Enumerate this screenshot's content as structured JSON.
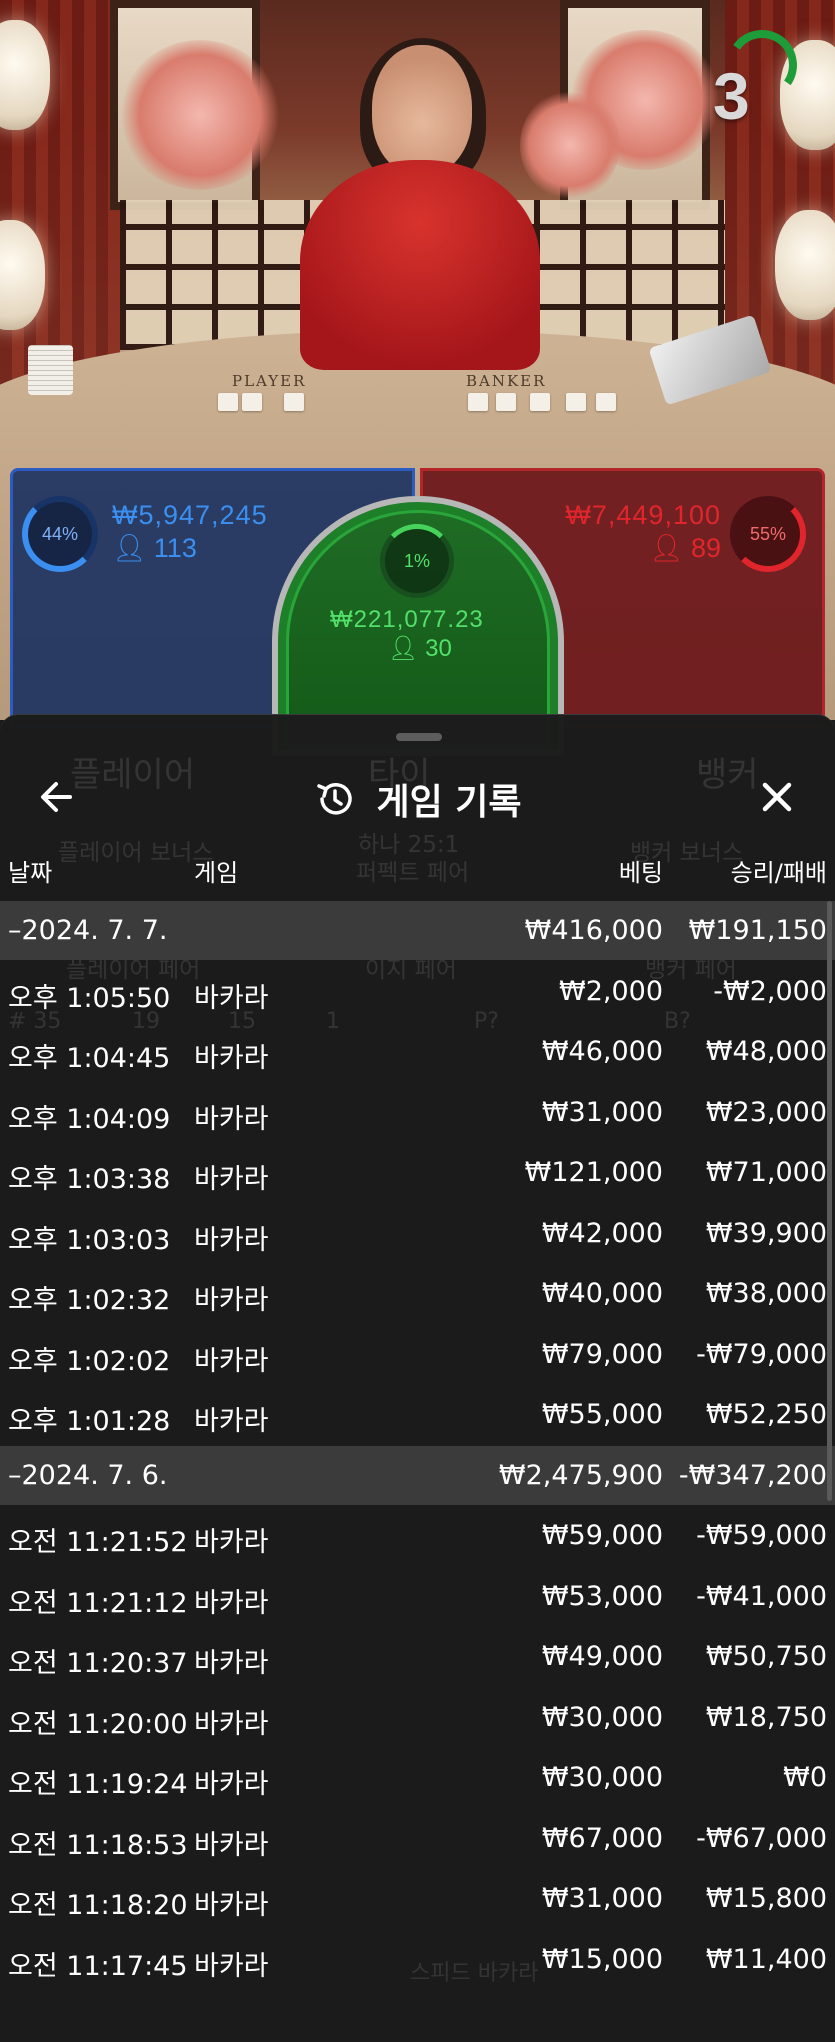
{
  "countdown": "3",
  "table_labels": {
    "player": "PLAYER",
    "banker": "BANKER"
  },
  "bets": {
    "player": {
      "percent": "44%",
      "amount": "₩5,947,245",
      "count": "113"
    },
    "banker": {
      "percent": "55%",
      "amount": "₩7,449,100",
      "count": "89"
    },
    "tie": {
      "percent": "1%",
      "amount": "₩221,077.23",
      "count": "30"
    }
  },
  "colors": {
    "player": "#3a8ff0",
    "banker": "#e0262c",
    "tie": "#53e06a",
    "sheet_bg": "#1b1b1b",
    "group_row": "#3b3b3b"
  },
  "background_ghosts": [
    "플레이어",
    "타이",
    "뱅커",
    "플레이어 보너스",
    "하나 25:1",
    "퍼펙트 페어",
    "뱅커 보너스",
    "플레이어 페어",
    "이지 페어",
    "뱅커 페어",
    "# 35",
    "19",
    "15",
    "1",
    "P?",
    "B?",
    "스피드 바카라"
  ],
  "sheet": {
    "title": "게임 기록",
    "icons": {
      "back": "arrow-left-icon",
      "title": "history-icon",
      "close": "close-icon"
    },
    "columns": {
      "date": "날짜",
      "game": "게임",
      "bet": "베팅",
      "result": "승리/패배"
    },
    "rows": [
      {
        "type": "group",
        "date": "–2024. 7. 7.",
        "game": "",
        "bet": "₩416,000",
        "result": "₩191,150"
      },
      {
        "type": "item",
        "date": "오후 1:05:50",
        "game": "바카라",
        "bet": "₩2,000",
        "result": "-₩2,000"
      },
      {
        "type": "item",
        "date": "오후 1:04:45",
        "game": "바카라",
        "bet": "₩46,000",
        "result": "₩48,000"
      },
      {
        "type": "item",
        "date": "오후 1:04:09",
        "game": "바카라",
        "bet": "₩31,000",
        "result": "₩23,000"
      },
      {
        "type": "item",
        "date": "오후 1:03:38",
        "game": "바카라",
        "bet": "₩121,000",
        "result": "₩71,000"
      },
      {
        "type": "item",
        "date": "오후 1:03:03",
        "game": "바카라",
        "bet": "₩42,000",
        "result": "₩39,900"
      },
      {
        "type": "item",
        "date": "오후 1:02:32",
        "game": "바카라",
        "bet": "₩40,000",
        "result": "₩38,000"
      },
      {
        "type": "item",
        "date": "오후 1:02:02",
        "game": "바카라",
        "bet": "₩79,000",
        "result": "-₩79,000"
      },
      {
        "type": "item",
        "date": "오후 1:01:28",
        "game": "바카라",
        "bet": "₩55,000",
        "result": "₩52,250"
      },
      {
        "type": "group",
        "date": "–2024. 7. 6.",
        "game": "",
        "bet": "₩2,475,900",
        "result": "-₩347,200"
      },
      {
        "type": "item",
        "date": "오전 11:21:52",
        "game": "바카라",
        "bet": "₩59,000",
        "result": "-₩59,000"
      },
      {
        "type": "item",
        "date": "오전 11:21:12",
        "game": "바카라",
        "bet": "₩53,000",
        "result": "-₩41,000"
      },
      {
        "type": "item",
        "date": "오전 11:20:37",
        "game": "바카라",
        "bet": "₩49,000",
        "result": "₩50,750"
      },
      {
        "type": "item",
        "date": "오전 11:20:00",
        "game": "바카라",
        "bet": "₩30,000",
        "result": "₩18,750"
      },
      {
        "type": "item",
        "date": "오전 11:19:24",
        "game": "바카라",
        "bet": "₩30,000",
        "result": "₩0"
      },
      {
        "type": "item",
        "date": "오전 11:18:53",
        "game": "바카라",
        "bet": "₩67,000",
        "result": "-₩67,000"
      },
      {
        "type": "item",
        "date": "오전 11:18:20",
        "game": "바카라",
        "bet": "₩31,000",
        "result": "₩15,800"
      },
      {
        "type": "item",
        "date": "오전 11:17:45",
        "game": "바카라",
        "bet": "₩15,000",
        "result": "₩11,400"
      }
    ]
  }
}
